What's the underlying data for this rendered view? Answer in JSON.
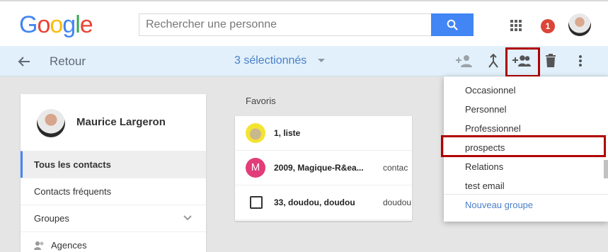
{
  "header": {
    "logo_letters": [
      {
        "char": "G",
        "color": "#4285f4"
      },
      {
        "char": "o",
        "color": "#ea4335"
      },
      {
        "char": "o",
        "color": "#fbbc05"
      },
      {
        "char": "g",
        "color": "#4285f4"
      },
      {
        "char": "l",
        "color": "#34a853"
      },
      {
        "char": "e",
        "color": "#ea4335"
      }
    ],
    "search_placeholder": "Rechercher une personne",
    "notification_count": "1"
  },
  "selection_bar": {
    "back_label": "Retour",
    "selected_label": "3 sélectionnés",
    "actions": [
      "add-contact-icon",
      "merge-icon",
      "add-to-group-icon",
      "delete-icon",
      "more-vert-icon"
    ]
  },
  "sidebar": {
    "user_name": "Maurice Largeron",
    "items": [
      {
        "label": "Tous les contacts",
        "active": true
      },
      {
        "label": "Contacts fréquents",
        "active": false
      },
      {
        "label": "Groupes",
        "active": false
      },
      {
        "label": "Agences",
        "active": false
      }
    ]
  },
  "favorites": {
    "title": "Favoris",
    "rows": [
      {
        "name": "1, liste",
        "extra": ""
      },
      {
        "name": "2009, Magique-R&ea...",
        "extra": "contac",
        "avatar_letter": "M"
      },
      {
        "name": "33, doudou, doudou",
        "extra": "doudou"
      }
    ]
  },
  "group_menu": {
    "items": [
      "Occasionnel",
      "Personnel",
      "Professionnel",
      "prospects",
      "Relations",
      "test email"
    ],
    "new_group_label": "Nouveau groupe"
  },
  "colors": {
    "accent": "#4285f4",
    "highlight": "#b00000",
    "selection_bar": "#e1f0fa",
    "link": "#4a7fc9"
  }
}
